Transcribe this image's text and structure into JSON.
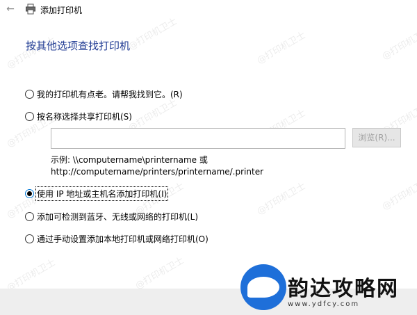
{
  "window": {
    "title": "添加打印机"
  },
  "heading": "按其他选项查找打印机",
  "options": [
    {
      "label": "我的打印机有点老。请帮我找到它。(R)",
      "selected": false
    },
    {
      "label": "按名称选择共享打印机(S)",
      "selected": false
    },
    {
      "label": "使用 IP 地址或主机名添加打印机(I)",
      "selected": true
    },
    {
      "label": "添加可检测到蓝牙、无线或网络的打印机(L)",
      "selected": false
    },
    {
      "label": "通过手动设置添加本地打印机或网络打印机(O)",
      "selected": false
    }
  ],
  "shared_printer": {
    "input_value": "",
    "browse_label": "浏览(R)...",
    "example_line1": "示例: \\\\computername\\printername 或",
    "example_line2": "http://computername/printers/printername/.printer"
  },
  "watermark": "@打印机卫士",
  "logo": {
    "name": "韵达攻略网",
    "url": "www.ydfcy.com"
  }
}
